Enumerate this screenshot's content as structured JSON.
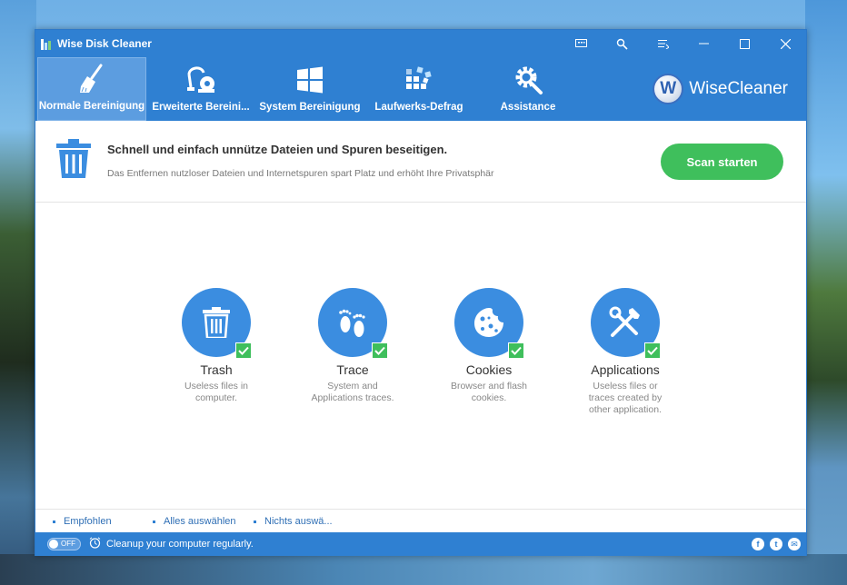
{
  "window": {
    "title": "Wise Disk Cleaner",
    "controls": [
      "feedback-icon",
      "tools-icon",
      "menu-icon",
      "minimize-icon",
      "maximize-icon",
      "close-icon"
    ]
  },
  "toolbar": {
    "tabs": [
      {
        "label": "Normale Bereinigung",
        "icon": "broom-icon",
        "active": true
      },
      {
        "label": "Erweiterte Bereini...",
        "icon": "vacuum-icon",
        "active": false
      },
      {
        "label": "System Bereinigung",
        "icon": "windows-icon",
        "active": false
      },
      {
        "label": "Laufwerks-Defrag",
        "icon": "defrag-icon",
        "active": false
      },
      {
        "label": "Assistance",
        "icon": "gear-wrench-icon",
        "active": false
      }
    ],
    "brand": {
      "logo_letter": "W",
      "name": "WiseCleaner"
    }
  },
  "header": {
    "title": "Schnell und einfach unnütze Dateien und Spuren beseitigen.",
    "subtitle": "Das Entfernen nutzloser Dateien und Internetspuren spart Platz und erhöht Ihre Privatsphär",
    "scan_label": "Scan starten"
  },
  "items": [
    {
      "name": "Trash",
      "desc": "Useless files in computer.",
      "icon": "trash-icon",
      "checked": true
    },
    {
      "name": "Trace",
      "desc": "System and Applications traces.",
      "icon": "footprints-icon",
      "checked": true
    },
    {
      "name": "Cookies",
      "desc": "Browser and flash cookies.",
      "icon": "cookie-icon",
      "checked": true
    },
    {
      "name": "Applications",
      "desc": "Useless files or traces created by other application.",
      "icon": "tools-icon",
      "checked": true
    }
  ],
  "links": {
    "recommended": "Empfohlen",
    "select_all": "Alles auswählen",
    "select_none": "Nichts auswä..."
  },
  "status": {
    "toggle_label": "OFF",
    "message": "Cleanup your computer regularly.",
    "social": [
      "f",
      "t",
      "✉"
    ]
  },
  "colors": {
    "primary": "#2f80d2",
    "accent_green": "#3fbf5c",
    "item_blue": "#3b8de0"
  }
}
